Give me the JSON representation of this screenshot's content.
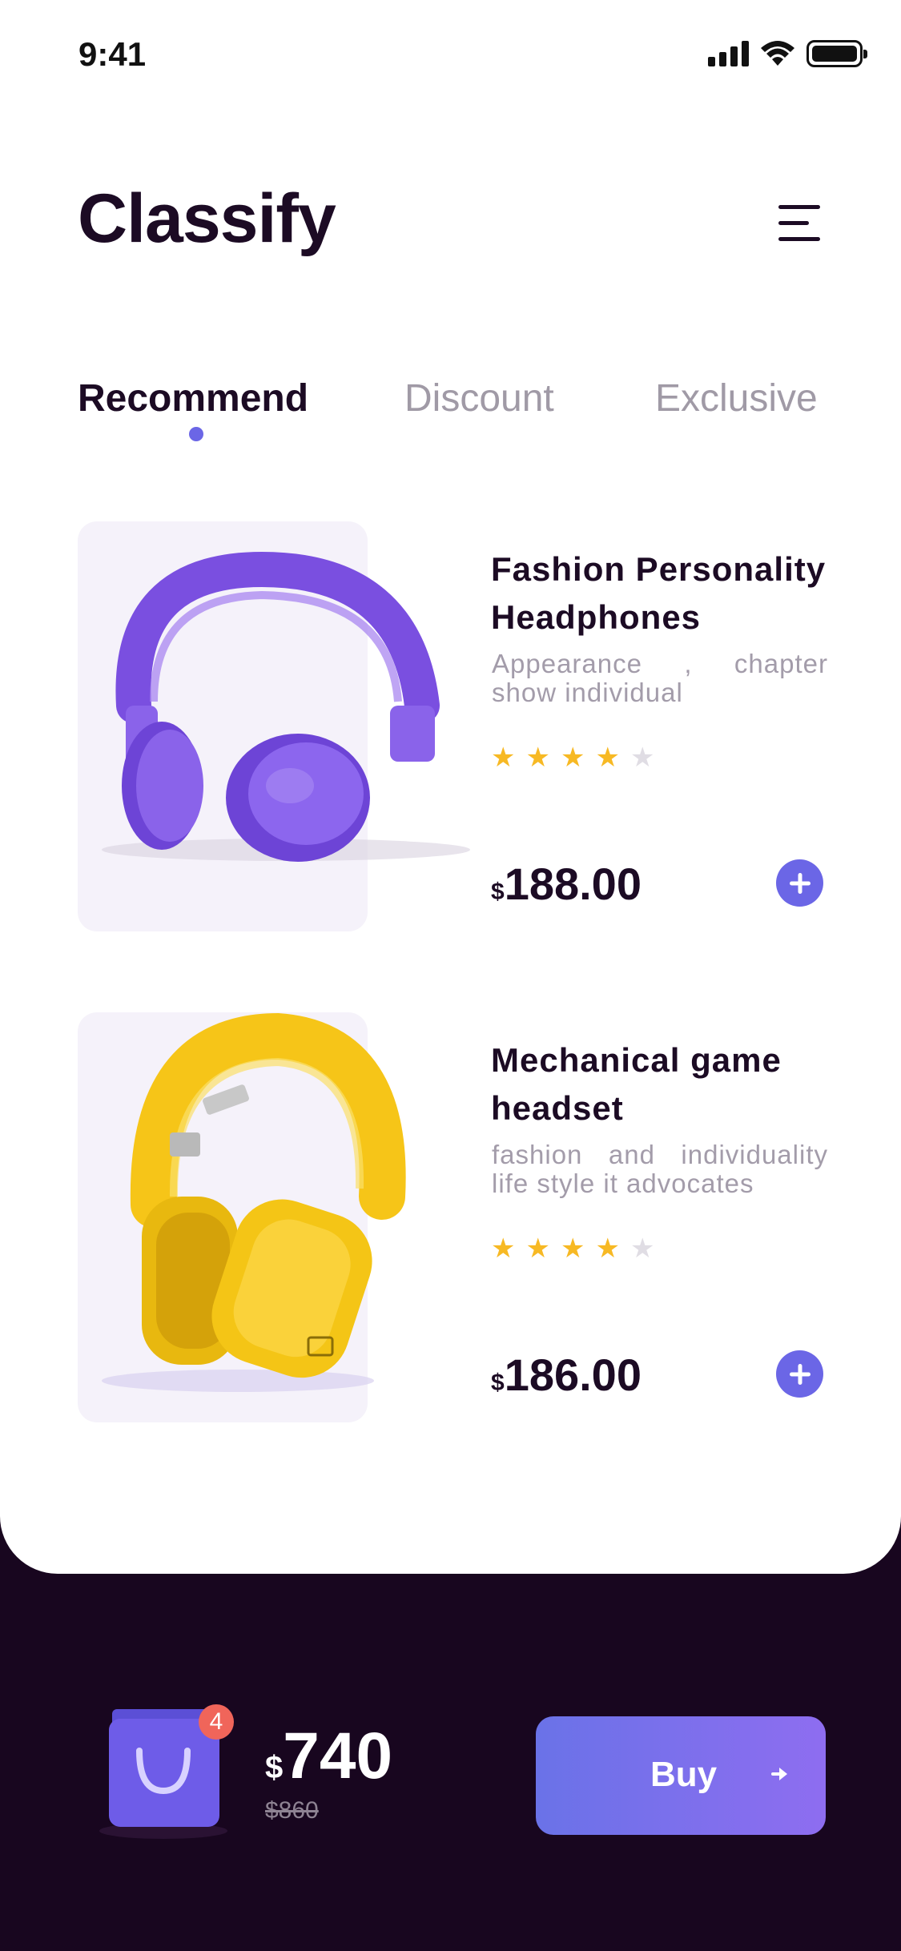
{
  "status_bar": {
    "time": "9:41"
  },
  "header": {
    "title": "Classify"
  },
  "tabs": [
    {
      "label": "Recommend",
      "active": true
    },
    {
      "label": "Discount",
      "active": false
    },
    {
      "label": "Exclusive",
      "active": false
    }
  ],
  "products": [
    {
      "name": "Fashion Personality Headphones",
      "description": "Appearance , chapter show individual",
      "rating": 4,
      "rating_max": 5,
      "currency": "$",
      "price": "188.00",
      "image_color": "#7a4fe0"
    },
    {
      "name": "Mechanical game headset",
      "description": "fashion and individuality life style it advocates",
      "rating": 4,
      "rating_max": 5,
      "currency": "$",
      "price": "186.00",
      "image_color": "#f6c518"
    }
  ],
  "cart": {
    "badge_count": "4",
    "currency": "$",
    "total": "740",
    "original_total": "$860",
    "buy_label": "Buy"
  },
  "colors": {
    "accent": "#6b66e6",
    "star": "#f7b924",
    "dark_background": "#18061f"
  }
}
